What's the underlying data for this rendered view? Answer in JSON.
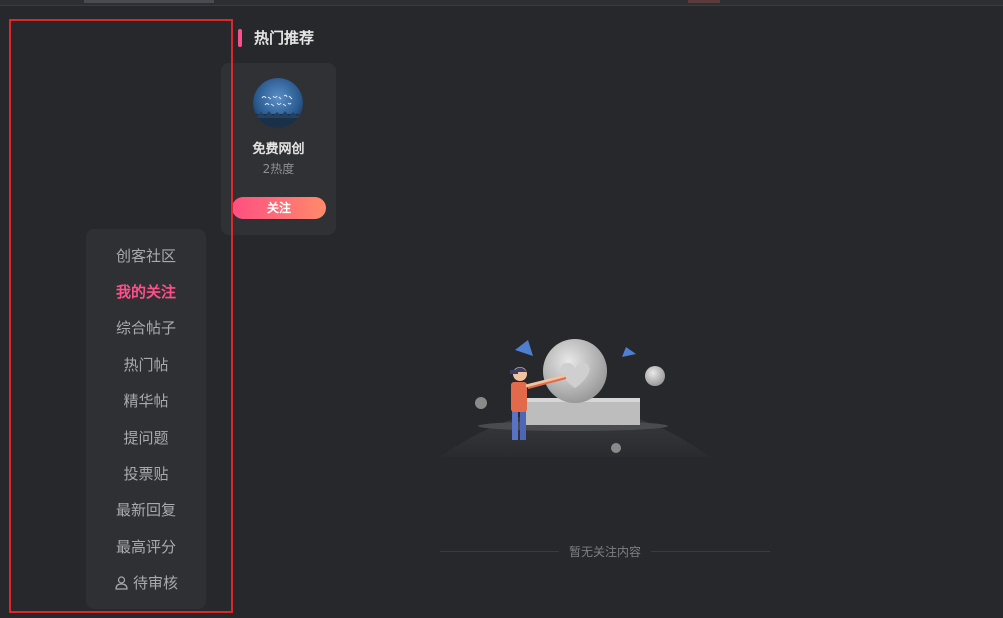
{
  "sidebar": {
    "items": [
      {
        "label": "创客社区",
        "active": false
      },
      {
        "label": "我的关注",
        "active": true
      },
      {
        "label": "综合帖子",
        "active": false
      },
      {
        "label": "热门帖",
        "active": false
      },
      {
        "label": "精华帖",
        "active": false
      },
      {
        "label": "提问题",
        "active": false
      },
      {
        "label": "投票贴",
        "active": false
      },
      {
        "label": "最新回复",
        "active": false
      },
      {
        "label": "最高评分",
        "active": false
      },
      {
        "label": "待审核",
        "active": false,
        "icon": "user-icon"
      }
    ]
  },
  "hot": {
    "title": "热门推荐",
    "card": {
      "name": "免费网创",
      "heat": "2热度",
      "follow_label": "关注"
    }
  },
  "empty": {
    "text": "暂无关注内容"
  },
  "colors": {
    "accent": "#ff4f8b",
    "background": "#27282b",
    "highlight_box": "#e0262a"
  }
}
